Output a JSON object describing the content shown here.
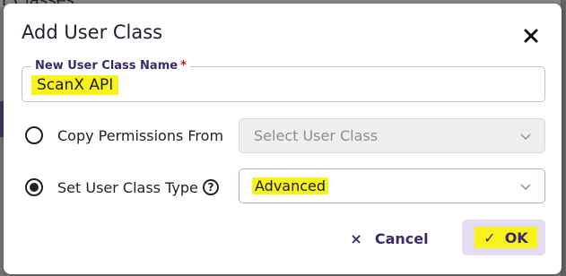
{
  "background": {
    "title_fragment": "r Classes"
  },
  "dialog": {
    "title": "Add User Class",
    "close_icon": "close-icon",
    "name_field": {
      "label": "New User Class Name",
      "required_mark": "*",
      "value": "ScanX API"
    },
    "options": [
      {
        "label": "Copy Permissions From",
        "selected": false,
        "select_value": "Select User Class",
        "disabled": true
      },
      {
        "label": "Set User Class Type",
        "selected": true,
        "select_value": "Advanced",
        "disabled": false,
        "help_icon": "help-icon",
        "help_glyph": "?"
      }
    ],
    "buttons": {
      "cancel_label": "Cancel",
      "cancel_glyph": "×",
      "ok_label": "OK",
      "ok_glyph": "✓"
    }
  },
  "colors": {
    "accent": "#3b2a6b",
    "highlight": "#f7f21c",
    "ok_bg": "#e3dcf2",
    "required": "#d0102b"
  }
}
